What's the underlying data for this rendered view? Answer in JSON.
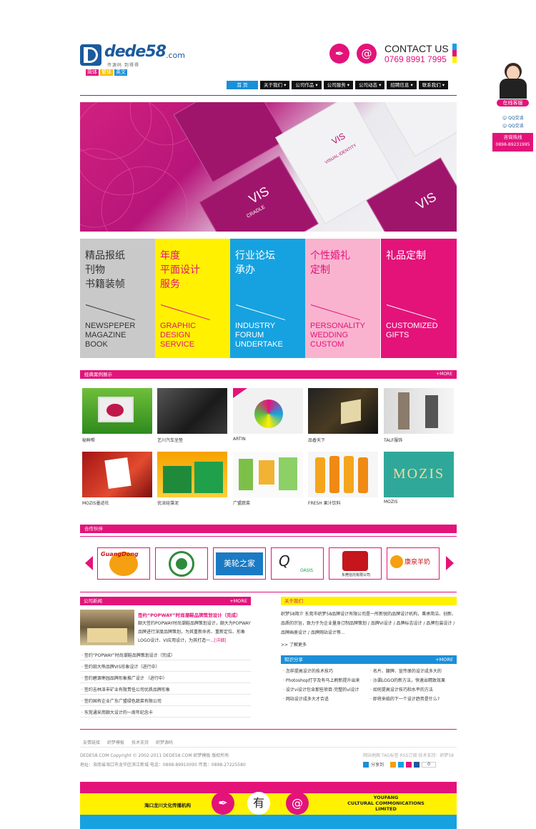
{
  "header": {
    "logo_text": "dede58",
    "logo_domain": ".com",
    "logo_sub": "传源码  到得得",
    "languages": [
      {
        "label": "简体",
        "color": "#e3137a"
      },
      {
        "label": "繁体",
        "color": "#f6c000"
      },
      {
        "label": "英文",
        "color": "#1b8fd8"
      }
    ],
    "contact_title": "CONTACT US",
    "contact_phone": "0769 8991 7995"
  },
  "nav": {
    "items": [
      "首 页",
      "关于我们",
      "公司作品",
      "公司服务",
      "公司动态",
      "招聘信息",
      "联系我们"
    ]
  },
  "banner": {
    "booklet_texts": [
      "VIS",
      "CRADLE",
      "VISUAL IDENTITY",
      "GUIDELINE"
    ]
  },
  "services": [
    {
      "cn": [
        "精品报纸",
        "刊物",
        "书籍装帧"
      ],
      "en": [
        "NEWSPEPER",
        "MAGAZINE",
        "BOOK"
      ],
      "bg": "#c9c9c9",
      "fg": "#333333",
      "line": "#333333"
    },
    {
      "cn": [
        "年度",
        "平面设计",
        "服务"
      ],
      "en": [
        "GRAPHIC",
        "DESIGN",
        "SERVICE"
      ],
      "bg": "#fff100",
      "fg": "#e3137a",
      "line": "#e3137a"
    },
    {
      "cn": [
        "行业论坛",
        "承办"
      ],
      "en": [
        "INDUSTRY",
        "FORUM",
        "UNDERTAKE"
      ],
      "bg": "#16a2e0",
      "fg": "#ffffff",
      "line": "#ffffff"
    },
    {
      "cn": [
        "个性婚礼",
        "定制"
      ],
      "en": [
        "PERSONALITY",
        "WEDDING",
        "CUSTOM"
      ],
      "bg": "#f9b3cf",
      "fg": "#e3137a",
      "line": "#e3137a"
    },
    {
      "cn": [
        "礼品定制"
      ],
      "en": [
        "CUSTOMIZED",
        "GIFTS"
      ],
      "bg": "#e3137a",
      "fg": "#ffffff",
      "line": "#ffffff"
    }
  ],
  "cases": {
    "title": "经典案例展示",
    "more": "+MORE",
    "items": [
      {
        "caption": "秘鲜帮"
      },
      {
        "caption": "艺川汽车坐垫"
      },
      {
        "caption": "ARTIN"
      },
      {
        "caption": "品香天下"
      },
      {
        "caption": "TALF服饰"
      },
      {
        "caption": "MOZIS墨迹社"
      },
      {
        "caption": "优派硅藻泥"
      },
      {
        "caption": "广盟蔬菜"
      },
      {
        "caption": "FRESH 果汁饮料"
      },
      {
        "caption": "MOZIS"
      }
    ],
    "mozis_logo": "MOZIS"
  },
  "partners": {
    "title": "合作伙伴",
    "items": [
      {
        "name": "GuangDong"
      },
      {
        "name": ""
      },
      {
        "name": "美轮之家"
      },
      {
        "name": "OASIS"
      },
      {
        "name": "东莞信托有限公司"
      },
      {
        "name": "康泉羊奶"
      }
    ]
  },
  "news": {
    "title": "公司新闻",
    "more": "+MORE",
    "featured_title": "签约“POPWAY”时尚潮鞋品牌策划设计（完成）",
    "featured_body": "颇大签约POPWAY时尚潮鞋品牌策划设计，颇大为POPWAY品牌进行深度品牌策划，为其重新命名、重新定位、形象LOGO设计、VI应用设计，为其打造一...",
    "featured_link": "[详细]",
    "items": [
      "签约“POPWAY”时尚潮鞋品牌策划设计（完成）",
      "签约田大熊品牌VIS形象设计（进行中）",
      "签约碧源枣园品牌形象推广设计 （进行中）",
      "签约吉林泽丰矿业有限责任公司优质品牌形象",
      "签约国有企业广东广盟绿色蔬菜有限公司",
      "东莞通采用颇大设计的一周年纪念卡"
    ]
  },
  "about": {
    "title": "关于我们",
    "body": "织梦58简介 东莞市织梦58品牌设计有限公司是一所新锐的品牌设计机构，秉承简洁、创新、品质的宗旨，致力于为企业量身订制品牌策划 / 品牌VI设计 / 品牌标志设计 / 品牌包装设计 / 品牌画册设计 / 品牌网站设计等...",
    "more": ">> 了解更多"
  },
  "knowledge": {
    "title": "知识分享",
    "more": "+MORE",
    "left": [
      "怎样提高设计的技术技巧",
      "Photoshop打字及有马上刷新提升出来",
      "设计vi设计包含那些项目-完整的vi设计",
      "网站设计成多大才合适"
    ],
    "right": [
      "名片、腰牌、宣传册的设计成多大的",
      "沙漏LOGO的新方法，快速出精致效果",
      "如何提高设计技巧和水平的方法",
      "即将来临的下一个设计趋势是什么?"
    ]
  },
  "footer": {
    "links": [
      "友情链接",
      "织梦模板",
      "技术支持",
      "织梦源码"
    ],
    "copyright": "DEDE58.COM   Copyright © 2002-2011 DEDE58.COM 织梦模板 版权所有",
    "address": "地址：海南省海口市龙华区滨江新城    电话：0898-89910095   传真：0898-27225580",
    "right_links": "网站地图  TAG标签  RSS订阅  技术支持：织梦58",
    "share_label": "分享到",
    "share_count": "0"
  },
  "bottom_banner": {
    "left_text": "海口龙川文化传播机构",
    "right_text": [
      "YOUFANG",
      "CULTURAL COMMONICATIONS",
      "LIMITED"
    ],
    "center_char": "有"
  },
  "side_widget": {
    "badge": "在线客服",
    "qq_labels": [
      "QQ交谈",
      "QQ交谈"
    ],
    "hotline_title": "咨询热线",
    "hotline": "0898-89231995"
  },
  "colors": {
    "accent": "#e3137a",
    "brand_blue": "#1b5a9c",
    "yellow": "#fff100",
    "cyan": "#16a2e0"
  }
}
